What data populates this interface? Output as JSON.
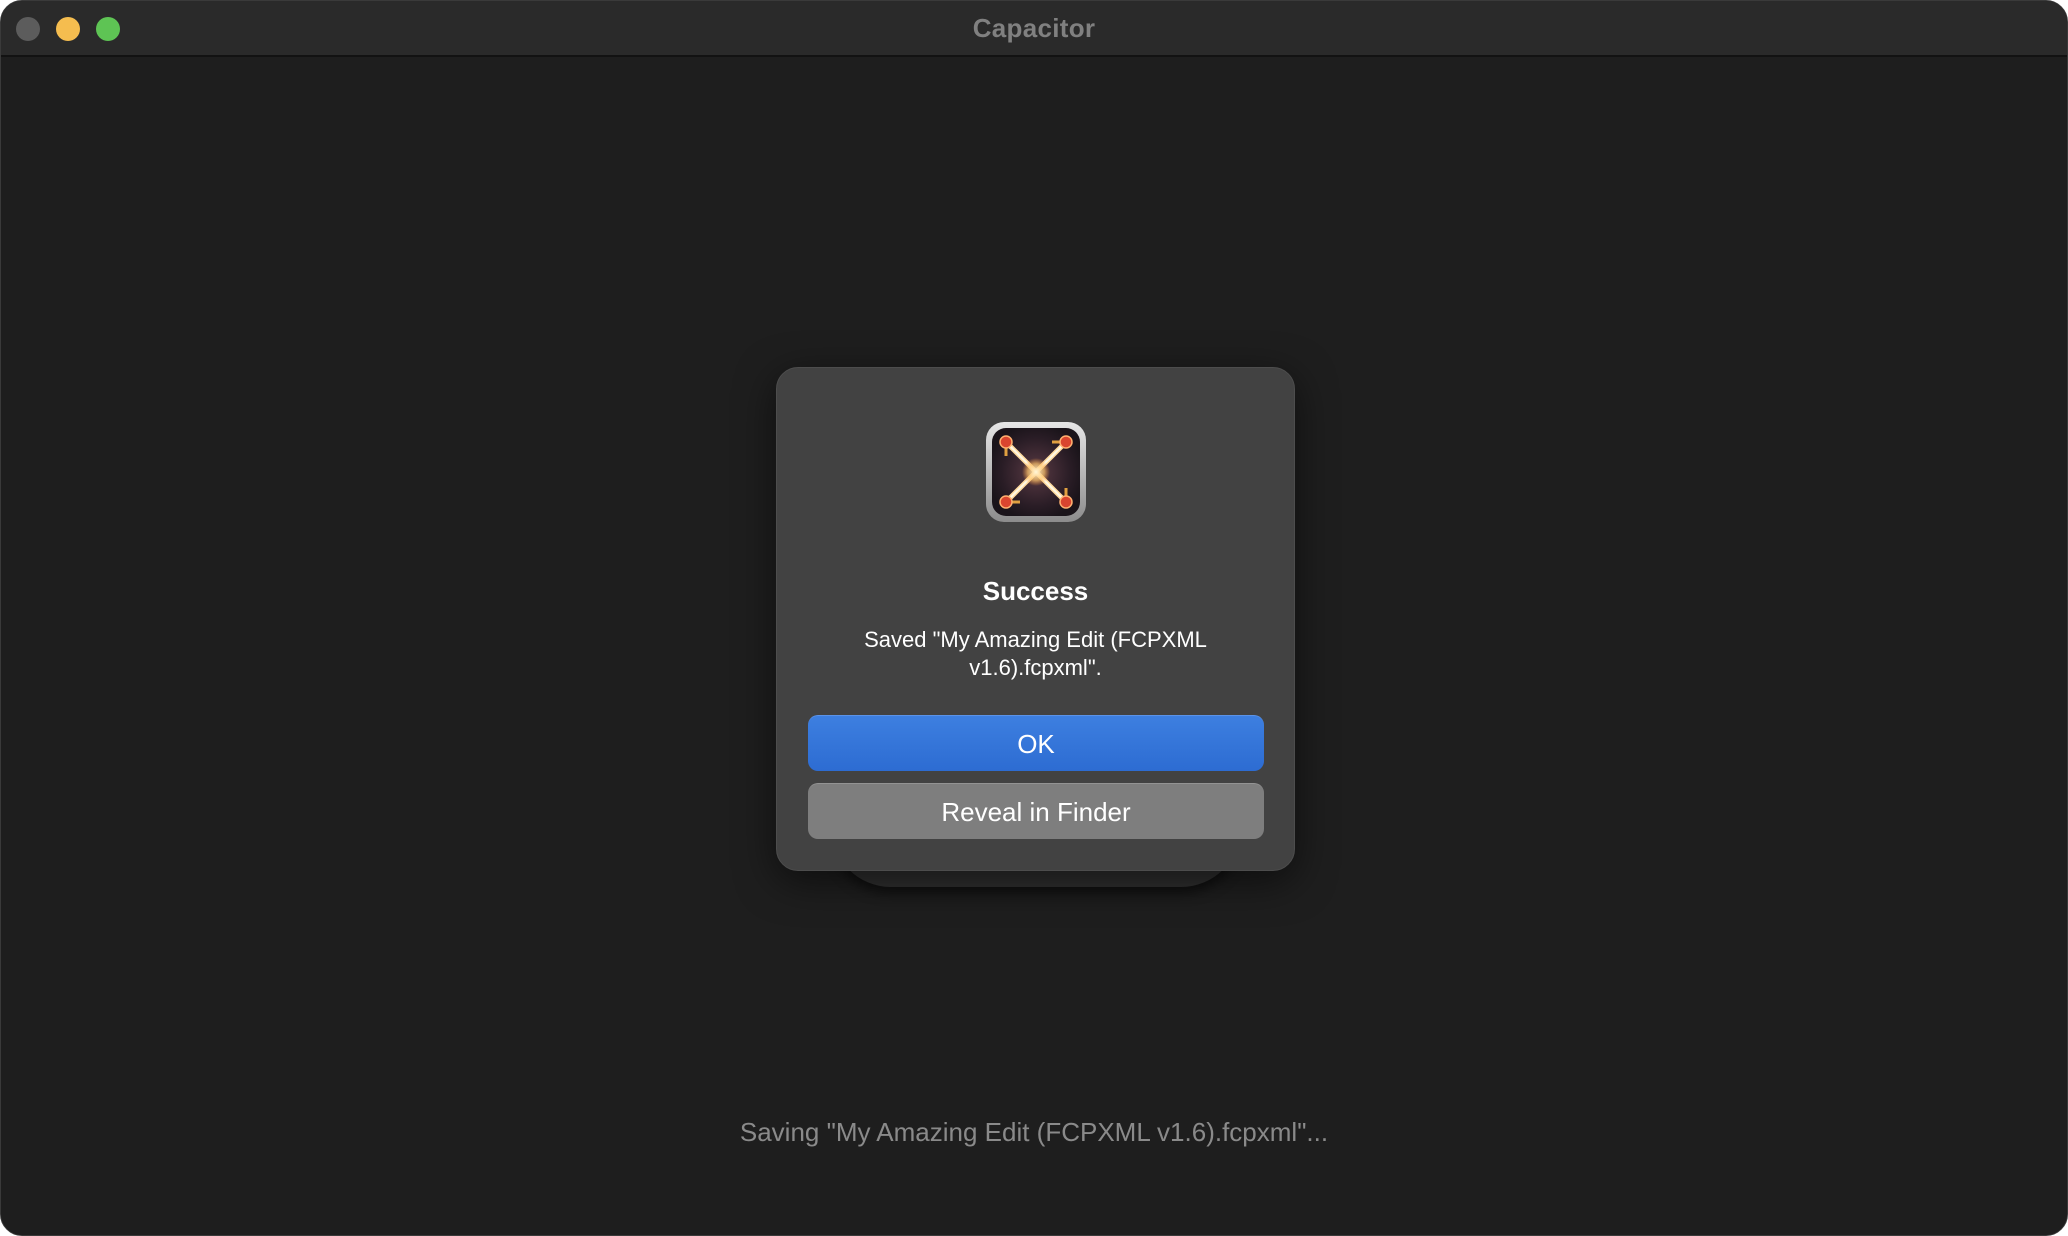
{
  "window": {
    "title": "Capacitor"
  },
  "icons": {
    "close": "close-dot-icon",
    "minimize": "minimize-dot-icon",
    "zoom": "zoom-dot-icon",
    "app": "capacitor-app-icon"
  },
  "dialog": {
    "title": "Success",
    "message": "Saved \"My Amazing Edit (FCPXML v1.6).fcpxml\".",
    "ok_label": "OK",
    "reveal_label": "Reveal in Finder"
  },
  "status": {
    "text": "Saving \"My Amazing Edit (FCPXML v1.6).fcpxml\"..."
  },
  "colors": {
    "accent": "#2d6cd2",
    "window_bg": "#1e1e1e",
    "dialog_bg": "#424242",
    "close": "#5c5c5c",
    "minimize": "#f5bd4f",
    "zoom": "#5ec454"
  }
}
